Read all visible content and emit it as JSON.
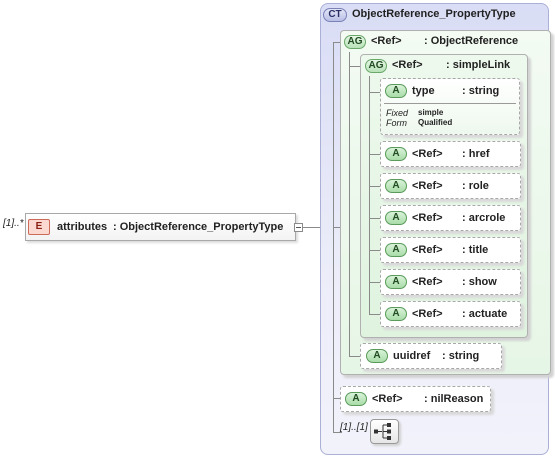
{
  "root": {
    "occurs": "[1]..*",
    "badge": "E",
    "name": "attributes",
    "type": ": ObjectReference_PropertyType"
  },
  "complex_type": {
    "badge": "CT",
    "name": "ObjectReference_PropertyType"
  },
  "group_outer": {
    "badge": "AG",
    "ref": "<Ref>",
    "name": ": ObjectReference"
  },
  "group_inner": {
    "badge": "AG",
    "ref": "<Ref>",
    "name": ": simpleLink"
  },
  "type_attr": {
    "badge": "A",
    "name": "type",
    "type": ": string",
    "fixed_label": "Fixed",
    "fixed_value": "simple",
    "form_label": "Form",
    "form_value": "Qualified"
  },
  "attrs": [
    {
      "badge": "A",
      "ref": "<Ref>",
      "name": ": href"
    },
    {
      "badge": "A",
      "ref": "<Ref>",
      "name": ": role"
    },
    {
      "badge": "A",
      "ref": "<Ref>",
      "name": ": arcrole"
    },
    {
      "badge": "A",
      "ref": "<Ref>",
      "name": ": title"
    },
    {
      "badge": "A",
      "ref": "<Ref>",
      "name": ": show"
    },
    {
      "badge": "A",
      "ref": "<Ref>",
      "name": ": actuate"
    }
  ],
  "uuidref": {
    "badge": "A",
    "name": "uuidref",
    "type": ": string"
  },
  "nilreason": {
    "badge": "A",
    "ref": "<Ref>",
    "name": ": nilReason"
  },
  "sequence": {
    "occurs": "[1]..[1]",
    "icon": "sequence-icon"
  }
}
